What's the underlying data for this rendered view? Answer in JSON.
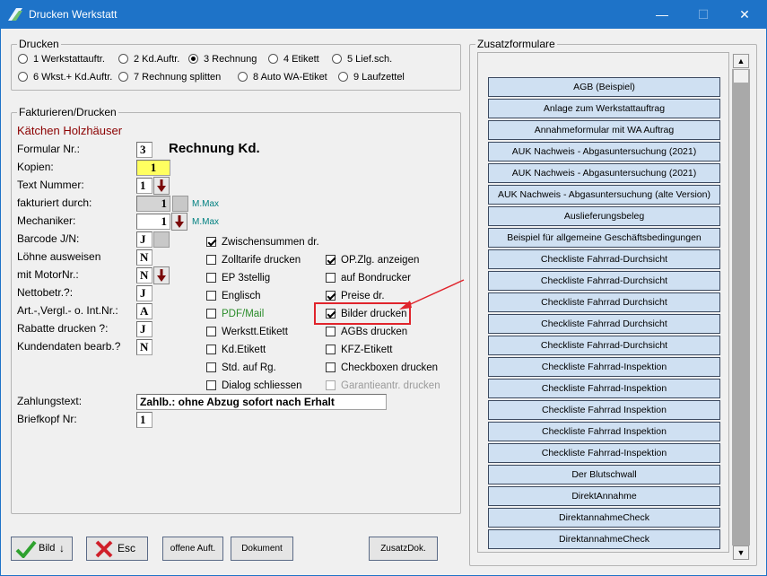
{
  "window": {
    "title": "Drucken Werkstatt",
    "min_glyph": "—",
    "max_glyph": "☐",
    "close_glyph": "✕"
  },
  "drucken": {
    "legend": "Drucken",
    "options": [
      "1 Werkstattauftr.",
      "2 Kd.Auftr.",
      "3 Rechnung",
      "4 Etikett",
      "5 Lief.sch.",
      "6 Wkst.+ Kd.Auftr.",
      "7 Rechnung splitten",
      "8 Auto WA-Etiket",
      "9 Laufzettel"
    ],
    "selected": "3 Rechnung"
  },
  "fakt": {
    "legend": "Fakturieren/Drucken",
    "customer": "Kätchen Holzhäuser",
    "labels": {
      "formular": "Formular Nr.:",
      "kopien": "Kopien:",
      "text": "Text Nummer:",
      "fakturiert": "fakturiert durch:",
      "mechaniker": "Mechaniker:",
      "barcode": "Barcode J/N:",
      "loehne": "Löhne ausweisen",
      "motor": "mit MotorNr.:",
      "netto": "Nettobetr.?:",
      "art": "Art.-,Vergl.- o. Int.Nr.:",
      "rabatte": "Rabatte drucken ?:",
      "kunden": "Kundendaten bearb.?",
      "zahlung": "Zahlungstext:",
      "briefkopf": "Briefkopf Nr:"
    },
    "values": {
      "formular": "3",
      "formular_name": "Rechnung Kd.",
      "kopien": "1",
      "text": "1",
      "fakturiert": "1",
      "fakturiert_name": "M.Max",
      "mechaniker": "1",
      "mechaniker_name": "M.Max",
      "barcode": "J",
      "loehne": "N",
      "motor": "N",
      "netto": "J",
      "art": "A",
      "rabatte": "J",
      "kunden": "N",
      "zahlung": "Zahlb.: ohne Abzug sofort nach Erhalt",
      "briefkopf": "1"
    },
    "checks_left": [
      {
        "label": "Zwischensummen dr.",
        "checked": true
      },
      {
        "label": "Zolltarife drucken",
        "checked": false
      },
      {
        "label": "EP 3stellig",
        "checked": false
      },
      {
        "label": "Englisch",
        "checked": false
      },
      {
        "label": "PDF/Mail",
        "checked": false
      },
      {
        "label": "Werkstt.Etikett",
        "checked": false
      },
      {
        "label": "Kd.Etikett",
        "checked": false
      },
      {
        "label": "Std. auf Rg.",
        "checked": false
      },
      {
        "label": "Dialog schliessen",
        "checked": false
      }
    ],
    "checks_right": [
      {
        "label": "OP.Zlg. anzeigen",
        "checked": true
      },
      {
        "label": "auf Bondrucker",
        "checked": false
      },
      {
        "label": "Preise dr.",
        "checked": true
      },
      {
        "label": "Bilder drucken",
        "checked": true
      },
      {
        "label": "AGBs drucken",
        "checked": false
      },
      {
        "label": "KFZ-Etikett",
        "checked": false
      },
      {
        "label": "Checkboxen drucken",
        "checked": false
      },
      {
        "label": "Garantieantr. drucken",
        "checked": false
      }
    ]
  },
  "zusatz": {
    "legend": "Zusatzformulare",
    "items": [
      "AGB (Beispiel)",
      "Anlage zum Werkstattauftrag",
      "Annahmeformular mit WA Auftrag",
      "AUK Nachweis - Abgasuntersuchung (2021)",
      "AUK Nachweis - Abgasuntersuchung (2021)",
      "AUK Nachweis - Abgasuntersuchung (alte Version)",
      "Auslieferungsbeleg",
      "Beispiel für allgemeine Geschäftsbedingungen",
      "Checkliste Fahrrad-Durchsicht",
      "Checkliste Fahrrad-Durchsicht",
      "Checkliste Fahrrad Durchsicht",
      "Checkliste Fahrrad Durchsicht",
      "Checkliste Fahrrad-Durchsicht",
      "Checkliste Fahrrad-Inspektion",
      "Checkliste Fahrrad-Inspektion",
      "Checkliste Fahrrad Inspektion",
      "Checkliste Fahrrad Inspektion",
      "Checkliste Fahrrad-Inspektion",
      "Der Blutschwall",
      "DirektAnnahme",
      "DirektannahmeCheck",
      "DirektannahmeCheck"
    ]
  },
  "buttons": {
    "bild": "Bild",
    "esc": "Esc",
    "offene": "offene Auft.",
    "dokument": "Dokument",
    "zusatzdok": "ZusatzDok."
  }
}
